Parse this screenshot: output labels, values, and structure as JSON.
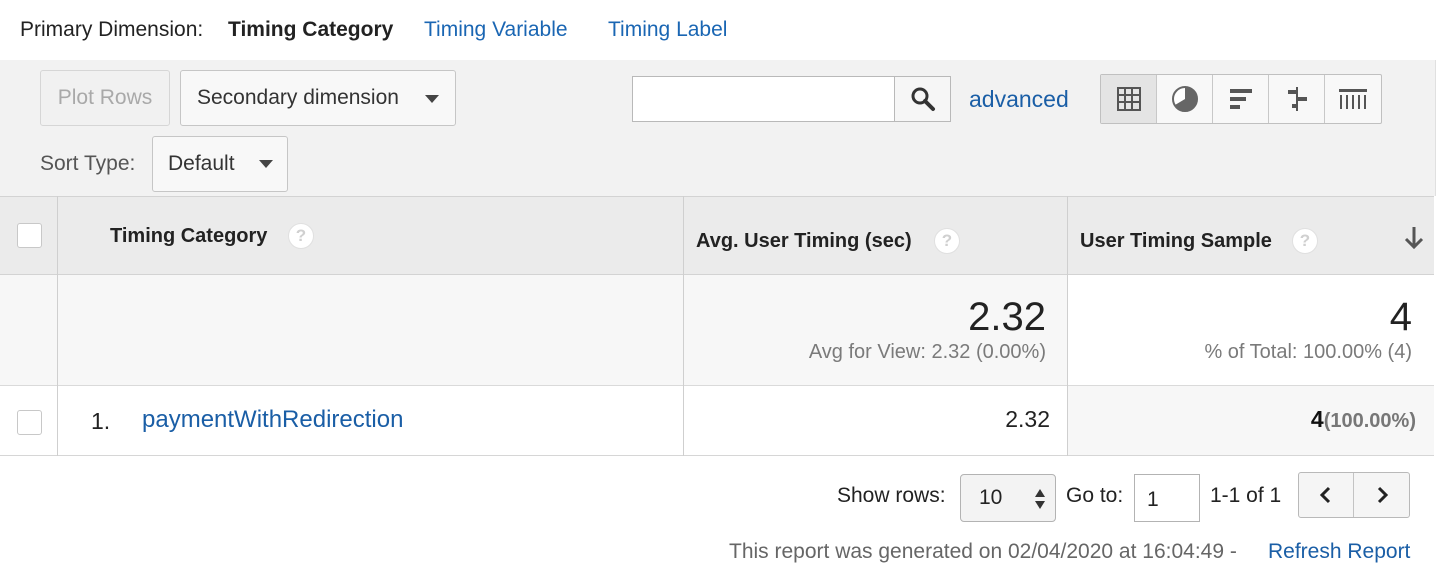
{
  "primary_dimension": {
    "label": "Primary Dimension:",
    "current": "Timing Category",
    "options": [
      "Timing Variable",
      "Timing Label"
    ]
  },
  "toolbar": {
    "plot_rows_label": "Plot Rows",
    "secondary_dimension_label": "Secondary dimension",
    "search": {
      "value": "",
      "placeholder": ""
    },
    "advanced_label": "advanced",
    "views": [
      "table-view-icon",
      "pie-chart-icon",
      "performance-icon",
      "comparison-icon",
      "pivot-icon"
    ],
    "sort_type_label": "Sort Type:",
    "sort_type_value": "Default"
  },
  "table": {
    "columns": [
      {
        "label": "Timing Category"
      },
      {
        "label": "Avg. User Timing (sec)"
      },
      {
        "label": "User Timing Sample"
      }
    ],
    "totals": {
      "avg_user_timing": "2.32",
      "avg_user_timing_sub": "Avg for View: 2.32 (0.00%)",
      "user_timing_sample": "4",
      "user_timing_sample_sub": "% of Total: 100.00% (4)"
    },
    "rows": [
      {
        "index": "1.",
        "category": "paymentWithRedirection",
        "avg_user_timing": "2.32",
        "sample_value": "4",
        "sample_pct": "(100.00%)"
      }
    ]
  },
  "pagination": {
    "show_rows_label": "Show rows:",
    "show_rows_value": "10",
    "goto_label": "Go to:",
    "goto_value": "1",
    "range_text": "1-1 of 1"
  },
  "footer": {
    "note": "This report was generated on 02/04/2020 at 16:04:49 - ",
    "refresh_label": "Refresh Report"
  },
  "colors": {
    "link": "#1a5ea6",
    "toolbar_bg": "#f2f2f2",
    "header_bg": "#ebebeb"
  }
}
